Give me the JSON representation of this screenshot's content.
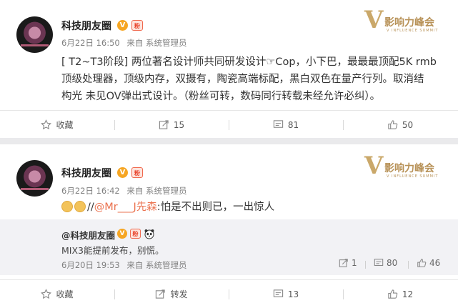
{
  "post1": {
    "author": "科技朋友圈",
    "v_badge": "V",
    "s_badge": "粉",
    "date": "6月22日 16:50",
    "source": "来自 系统管理员",
    "logo_v": "V",
    "logo_title": "影响力峰会",
    "logo_sub": "V INFLUENCE SUMMIT",
    "text_line1": "[ T2~T3阶段] 两位著名设计师共同研发设计☞Cop，小下巴，最最最顶配5K rmb",
    "text_line2": "顶级处理器，顶级内存，双摄有，陶瓷高端标配，黑白双色在量产行列。取消结",
    "text_line3": "构光 未见OV弹出式设计。（粉丝可转，数码同行转载未经允许必纠）。",
    "actions": {
      "favorite": "收藏",
      "repost": "15",
      "comment": "81",
      "like": "50"
    }
  },
  "post2": {
    "author": "科技朋友圈",
    "v_badge": "V",
    "s_badge": "粉",
    "date": "6月22日 16:42",
    "source": "来自 系统管理员",
    "logo_v": "V",
    "logo_title": "影响力峰会",
    "logo_sub": "V INFLUENCE SUMMIT",
    "reply_prefix": "//",
    "mention": "@Mr___J先森",
    "reply_text": ":怕是不出则已，一出惊人",
    "repost": {
      "author": "@科技朋友圈",
      "v_badge": "V",
      "s_badge": "粉",
      "text": "MIX3能提前发布，别慌。",
      "date": "6月20日 19:53",
      "source": "来自 系统管理员",
      "repost_count": "1",
      "comment_count": "80",
      "like_count": "46"
    },
    "actions": {
      "favorite": "收藏",
      "repost": "转发",
      "comment": "13",
      "like": "12"
    }
  },
  "colors": {
    "accent_link": "#eb7350",
    "logo_gold": "#caa86a",
    "vip_orange": "#f6a623"
  },
  "icons": [
    "star-icon",
    "repost-icon",
    "comment-icon",
    "like-icon",
    "panda-icon"
  ]
}
